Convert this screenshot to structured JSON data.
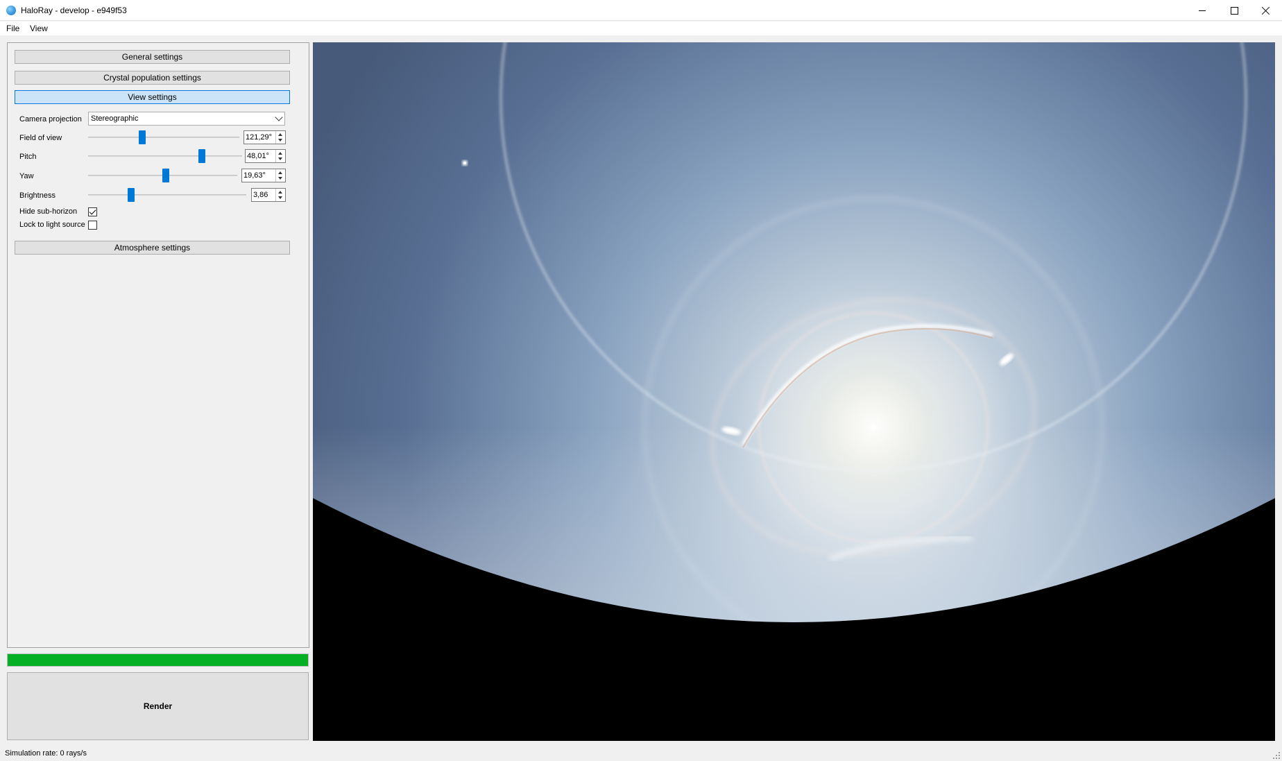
{
  "window": {
    "title": "HaloRay - develop - e949f53",
    "icon": "haloray-icon"
  },
  "menu": {
    "file": "File",
    "view": "View"
  },
  "sections": {
    "general": "General settings",
    "crystal": "Crystal population settings",
    "view": "View settings",
    "atmosphere": "Atmosphere settings"
  },
  "view_settings": {
    "camera_projection_label": "Camera projection",
    "camera_projection_value": "Stereographic",
    "fov_label": "Field of view",
    "fov_value": "121,29°",
    "fov_slider_fraction": 0.35,
    "pitch_label": "Pitch",
    "pitch_value": "48,01°",
    "pitch_slider_fraction": 0.75,
    "yaw_label": "Yaw",
    "yaw_value": "19,63°",
    "yaw_slider_fraction": 0.52,
    "brightness_label": "Brightness",
    "brightness_value": "3,86",
    "brightness_slider_fraction": 0.26,
    "hide_subhorizon_label": "Hide sub-horizon",
    "hide_subhorizon_checked": true,
    "lock_light_label": "Lock to light source",
    "lock_light_checked": false
  },
  "progress": {
    "fraction": 1.0,
    "color": "#06b025"
  },
  "render_button": "Render",
  "status": "Simulation rate: 0 rays/s",
  "colors": {
    "accent": "#0078d7",
    "active_section_bg": "#cce4f7"
  }
}
